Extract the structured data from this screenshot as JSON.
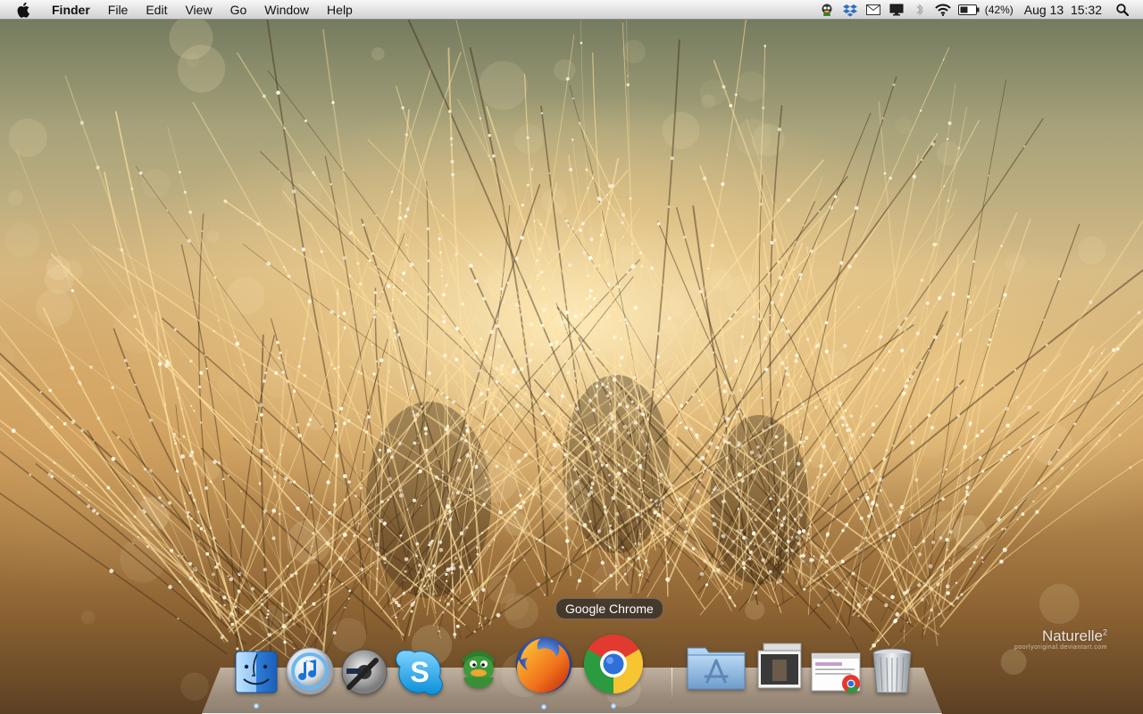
{
  "menubar": {
    "app_name": "Finder",
    "menus": [
      "File",
      "Edit",
      "View",
      "Go",
      "Window",
      "Help"
    ],
    "status": {
      "battery_text": "(42%)",
      "date": "Aug 13",
      "time": "15:32"
    }
  },
  "wallpaper": {
    "watermark": "Naturelle",
    "watermark_sup": "2",
    "watermark_sub": "poorlyoriginal.deviantart.com"
  },
  "dock": {
    "tooltip": "Google Chrome",
    "apps": [
      "Finder",
      "iTunes",
      "DVD Player",
      "Skype",
      "Adium",
      "Firefox",
      "Google Chrome"
    ],
    "stacks": [
      "Applications",
      "Screenshots",
      "Downloads",
      "Trash"
    ]
  },
  "colors": {
    "menubar_top": "#f7f7f7",
    "menubar_bottom": "#d2d2d2",
    "tooltip_bg": "#282828"
  }
}
